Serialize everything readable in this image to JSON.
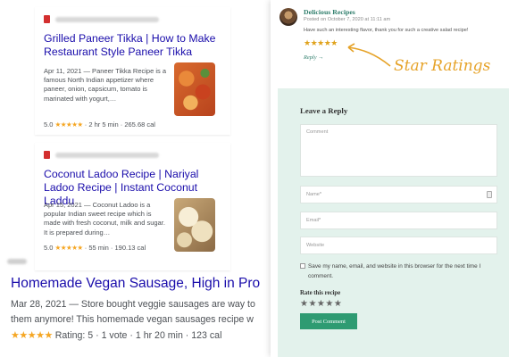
{
  "search_results": [
    {
      "title": "Grilled Paneer Tikka | How to Make Restaurant Style Paneer Tikka",
      "snippet": "Apr 11, 2021 — Paneer Tikka Recipe is a famous North Indian appetizer where paneer, onion, capsicum, tomato is marinated with yogurt,…",
      "rating": "5.0",
      "stars": "★★★★★",
      "meta": "· 2 hr 5 min · 265.68 cal"
    },
    {
      "title": "Coconut Ladoo Recipe | Nariyal Ladoo Recipe | Instant Coconut Laddu",
      "snippet": "Apr 15, 2021 — Coconut Ladoo is a popular Indian sweet recipe which is made with fresh coconut, milk and sugar. It is prepared during…",
      "rating": "5.0",
      "stars": "★★★★★",
      "meta": "· 55 min · 190.13 cal"
    }
  ],
  "main_result": {
    "title": "Homemade Vegan Sausage, High in Pro",
    "snippet_line1": "Mar 28, 2021 — Store bought veggie sausages are way to",
    "snippet_line2": "them anymore! This homemade vegan sausages recipe w",
    "stars": "★★★★★",
    "meta": "Rating: 5 · 1 vote · 1 hr 20 min · 123 cal"
  },
  "comment": {
    "author": "Delicious Recipes",
    "posted": "Posted on October 7, 2020 at 11:11 am",
    "text": "Have such an interesting flavor, thank you for such a creative salad recipe!",
    "stars": "★★★★★",
    "reply_label": "Reply →"
  },
  "annotation": {
    "label": "Star Ratings"
  },
  "reply_form": {
    "heading": "Leave a Reply",
    "comment_placeholder": "Comment",
    "name_placeholder": "Name*",
    "email_placeholder": "Email*",
    "website_placeholder": "Website",
    "save_label": "Save my name, email, and website in this browser for the next time I comment.",
    "rate_label": "Rate this recipe",
    "rate_stars": "★★★★★",
    "submit_label": "Post Comment"
  },
  "colors": {
    "link": "#1a0dab",
    "star": "#f5a623",
    "accent_green": "#2e9b72",
    "reply_bg": "#e3f2ec",
    "annotation": "#e6a329"
  }
}
